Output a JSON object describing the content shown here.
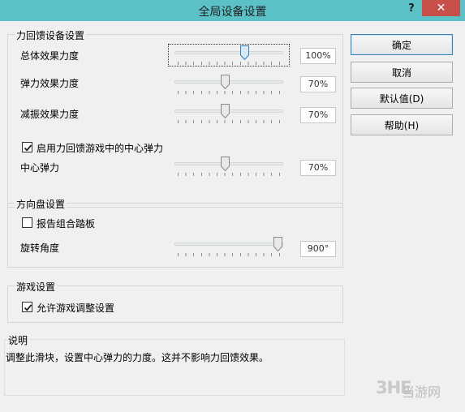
{
  "window": {
    "title": "全局设备设置",
    "help_glyph": "?",
    "close_glyph": "✕"
  },
  "force_feedback": {
    "group_title": "力回馈设备设置",
    "overall_label": "总体效果力度",
    "overall_value": "100%",
    "overall_level": 1.0,
    "spring_label": "弹力效果力度",
    "spring_value": "70%",
    "spring_level": 0.7,
    "damper_label": "减振效果力度",
    "damper_value": "70%",
    "damper_level": 0.7,
    "center_spring_checkbox_label": "启用力回馈游戏中的中心弹力",
    "center_spring_checked": true,
    "center_spring_label": "中心弹力",
    "center_spring_value": "70%",
    "center_spring_level": 0.7
  },
  "wheel": {
    "group_title": "方向盘设置",
    "pedals_checkbox_label": "报告组合踏板",
    "pedals_checked": false,
    "rotation_label": "旋转角度",
    "rotation_value": "900°",
    "rotation_level": 1.0
  },
  "game": {
    "group_title": "游戏设置",
    "allow_checkbox_label": "允许游戏调整设置",
    "allow_checked": true
  },
  "description": {
    "group_title": "说明",
    "text": "调整此滑块，设置中心弹力的力度。这并不影响力回馈效果。"
  },
  "buttons": {
    "ok_label": "确定",
    "cancel_label": "取消",
    "defaults_label": "默认值(D)",
    "help_label": "帮助(H)"
  },
  "watermark": {
    "logo": "3HE",
    "text": "当游网"
  },
  "colors": {
    "titlebar": "#5bc1c6",
    "close_button": "#c7504b",
    "default_button_border": "#3c7fb1"
  }
}
